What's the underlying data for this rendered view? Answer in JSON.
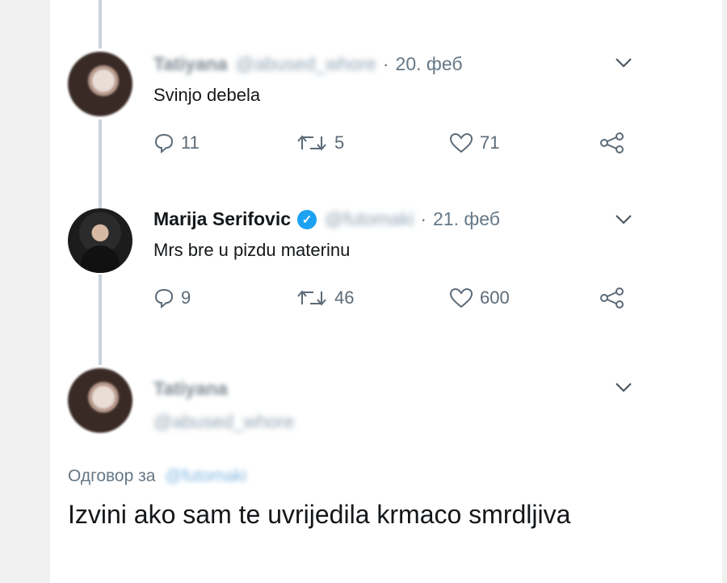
{
  "tweets": [
    {
      "display_name": "Tatiyana",
      "handle": "@abused_whore",
      "date": "20. феб",
      "text": "Svinjo debela",
      "replies": "11",
      "retweets": "5",
      "likes": "71"
    },
    {
      "display_name": "Marija Serifovic",
      "handle": "@futomaki",
      "verified_mark": "✓",
      "date": "21. феб",
      "text": "Mrs bre u pizdu materinu",
      "replies": "9",
      "retweets": "46",
      "likes": "600"
    },
    {
      "display_name": "Tatiyana",
      "handle": "@abused_whore",
      "reply_to_label": "Одговор за",
      "reply_to_handle": "@futomaki",
      "text": "Izvini ako sam te uvrijedila krmaco smrdljiva"
    }
  ],
  "icons": {
    "more": "chevron-down-icon",
    "reply": "reply-icon",
    "retweet": "retweet-icon",
    "like": "heart-icon",
    "share": "share-icon"
  },
  "colors": {
    "verified": "#1da1f2",
    "thread_line": "#c8d2dc",
    "secondary_text": "#657786"
  }
}
